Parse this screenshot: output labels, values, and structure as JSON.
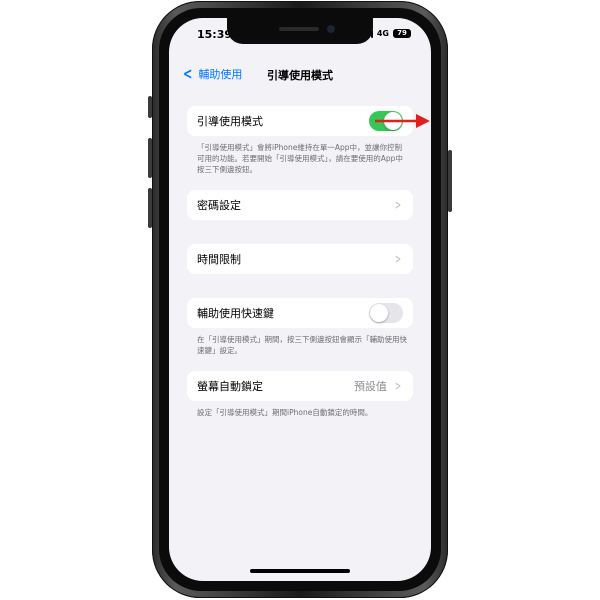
{
  "status_bar": {
    "time": "15:39",
    "network": "4G",
    "battery": "79"
  },
  "nav": {
    "back_label": "輔助使用",
    "title": "引導使用模式"
  },
  "guided_access": {
    "label": "引導使用模式",
    "enabled": true,
    "footnote": "「引導使用模式」會將iPhone維持在單一App中，並讓你控制可用的功能。若要開始「引導使用模式」，請在要使用的App中按三下側邊按鈕。"
  },
  "passcode_settings": {
    "label": "密碼設定"
  },
  "time_limits": {
    "label": "時間限制"
  },
  "accessibility_shortcut": {
    "label": "輔助使用快速鍵",
    "enabled": false,
    "footnote": "在「引導使用模式」期間，按三下側邊按鈕會顯示「輔助使用快速鍵」設定。"
  },
  "auto_lock": {
    "label": "螢幕自動鎖定",
    "value": "預設值",
    "footnote": "設定「引導使用模式」期間iPhone自動鎖定的時間。"
  },
  "colors": {
    "accent": "#007aff",
    "toggle_on": "#34c759",
    "annotation_arrow": "#e02020",
    "background": "#f2f2f7"
  }
}
